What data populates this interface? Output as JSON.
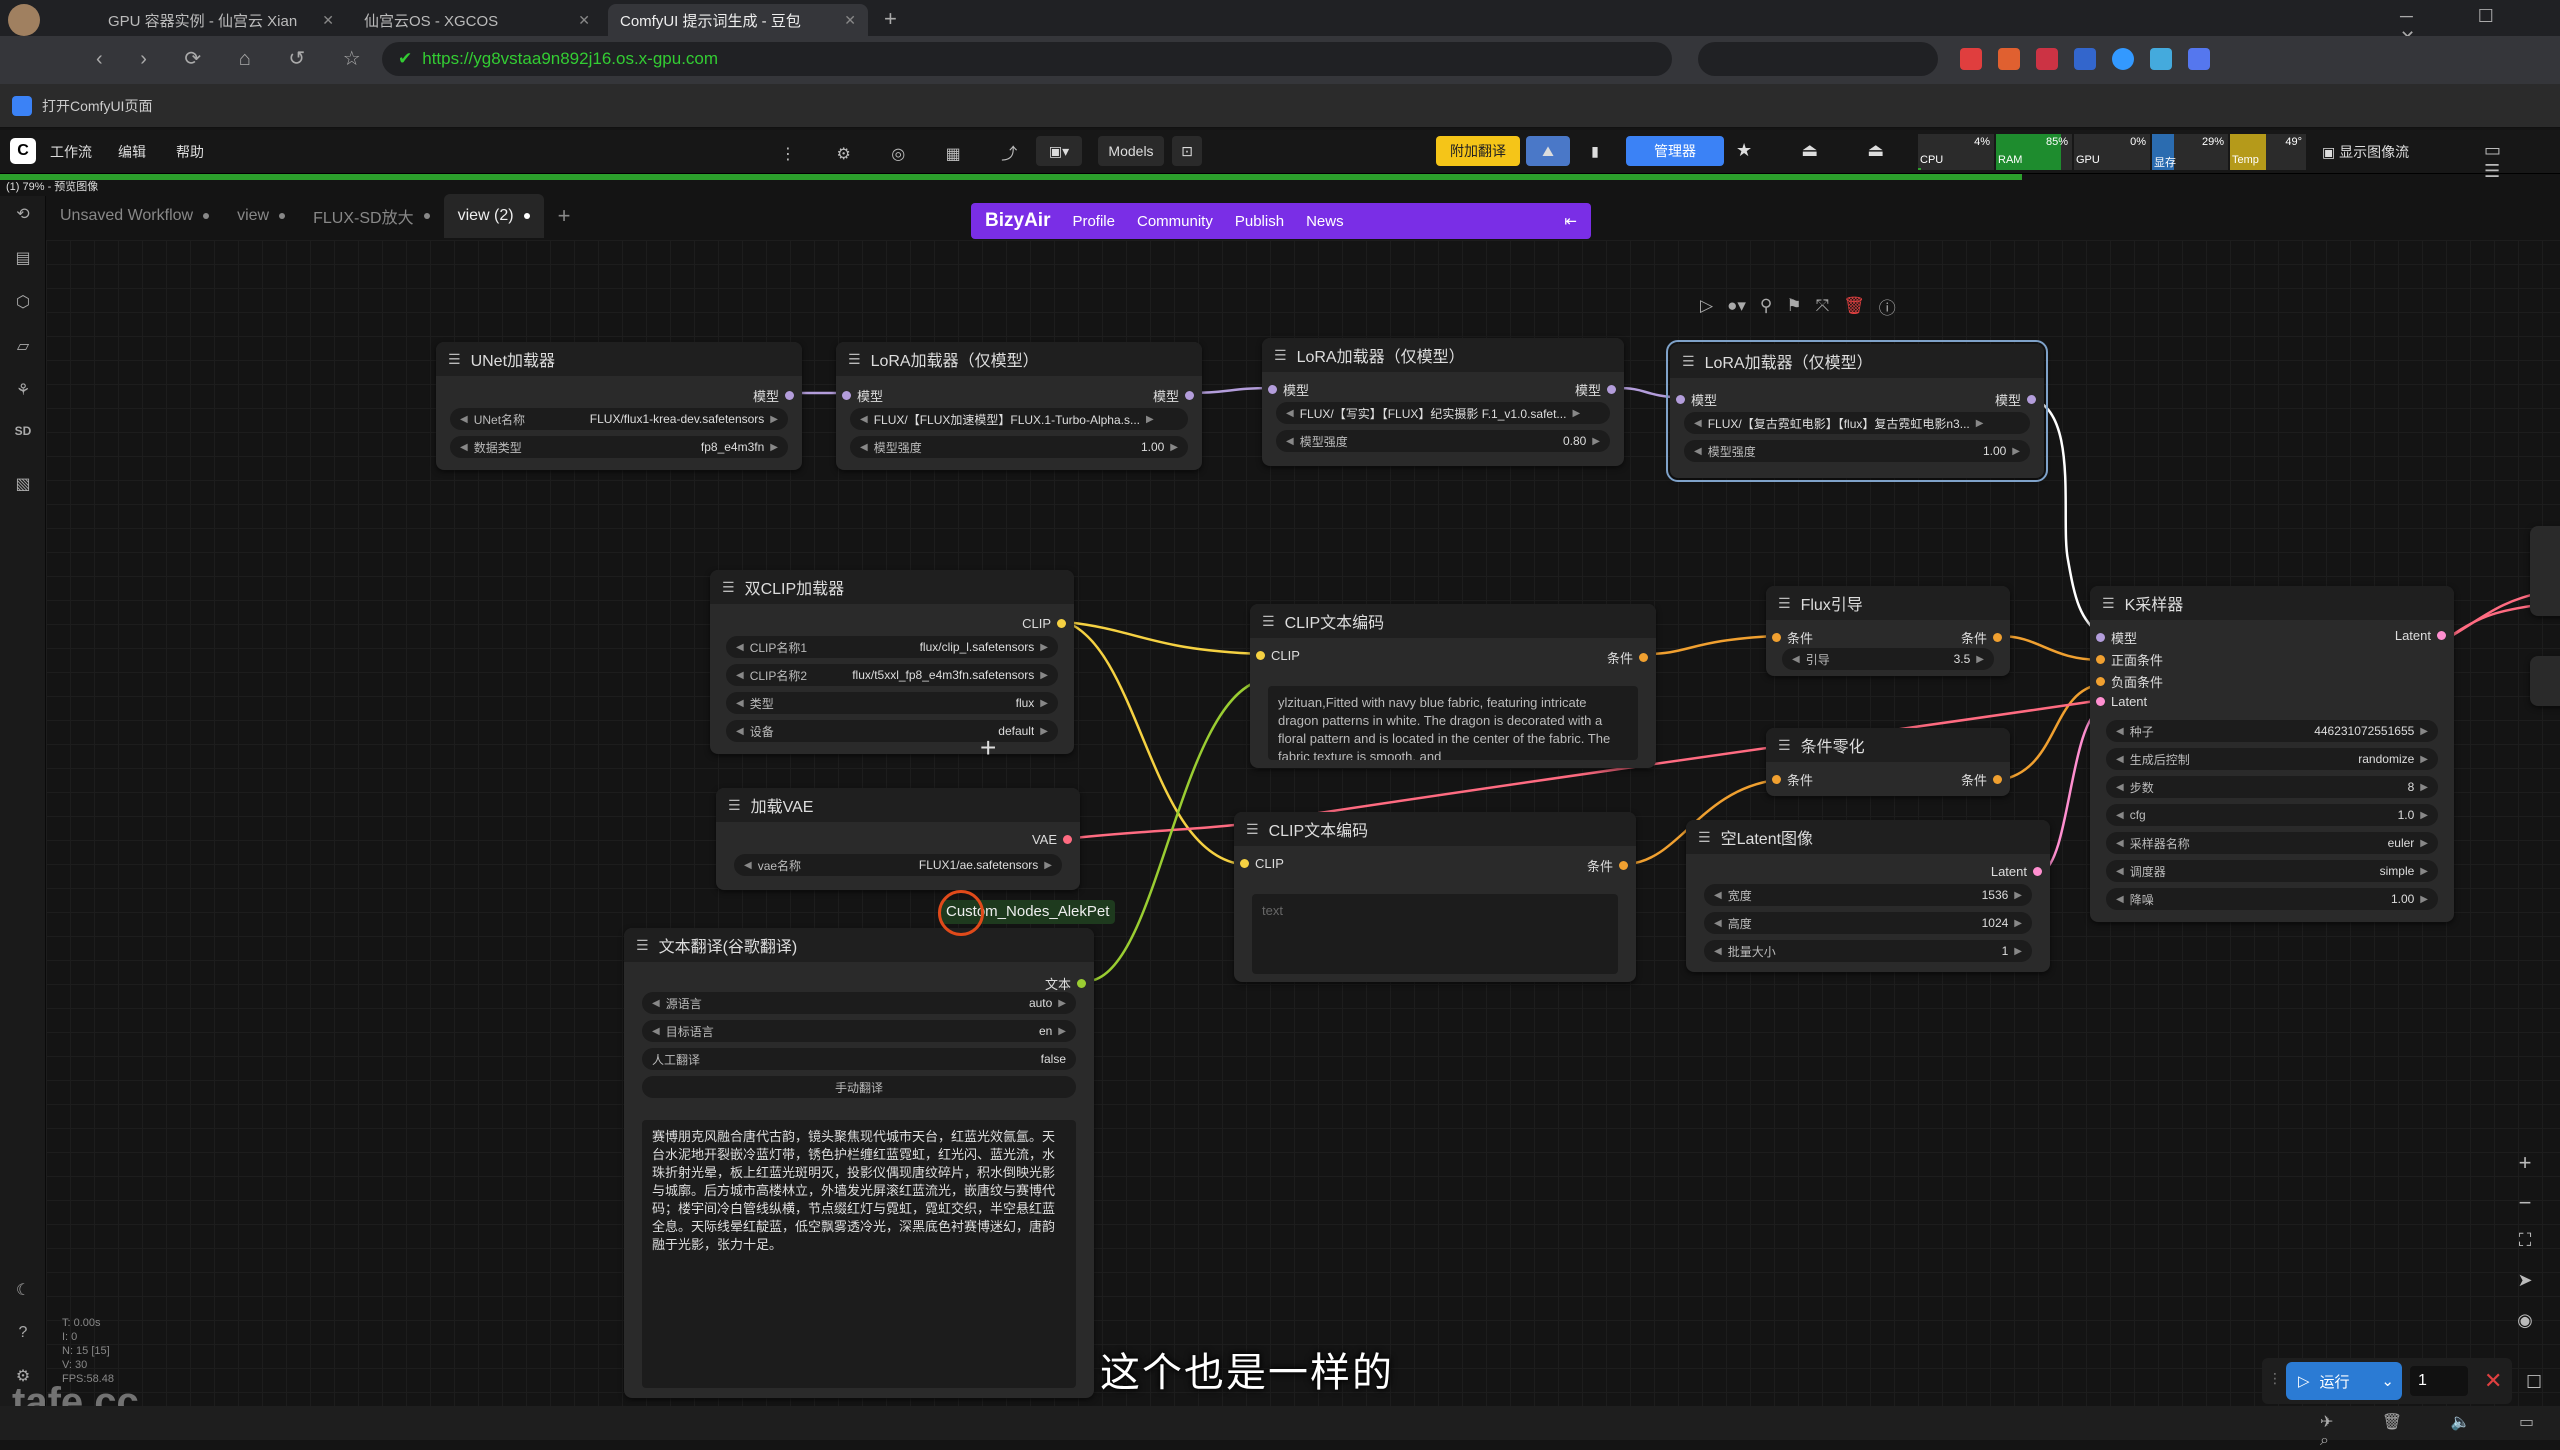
{
  "browser": {
    "tabs": [
      {
        "title": "GPU 容器实例 - 仙宫云 Xian"
      },
      {
        "title": "仙宫云OS - XGCOS"
      },
      {
        "title": "ComfyUI 提示词生成 - 豆包"
      }
    ],
    "url": "https://yg8vstaa9n892j16.os.x-gpu.com",
    "page_title": "打开ComfyUI页面"
  },
  "comfy_menu": {
    "items": [
      "工作流",
      "编辑",
      "帮助"
    ],
    "models_label": "Models",
    "translate_label": "附加翻译",
    "manager_label": "管理器",
    "stats": {
      "cpu_label": "CPU",
      "cpu": "4%",
      "ram_label": "RAM",
      "ram": "85%",
      "gpu_label": "GPU",
      "gpu": "0%",
      "vram_label": "显存",
      "vram": "29%",
      "temp_label": "Temp",
      "temp": "49°"
    },
    "display_label": "显示图像流"
  },
  "progress": {
    "text": "(1) 79% - 预览图像",
    "fraction": 0.79
  },
  "workflow_tabs": [
    {
      "label": "Unsaved Workflow",
      "active": false
    },
    {
      "label": "view",
      "active": false
    },
    {
      "label": "FLUX-SD放大",
      "active": false
    },
    {
      "label": "view (2)",
      "active": true
    }
  ],
  "bizyair": {
    "brand": "BizyAir",
    "links": [
      "Profile",
      "Community",
      "Publish",
      "News"
    ]
  },
  "nodes": {
    "unet": {
      "title": "UNet加载器",
      "out": "模型",
      "w1l": "UNet名称",
      "w1v": "FLUX/flux1-krea-dev.safetensors",
      "w2l": "数据类型",
      "w2v": "fp8_e4m3fn"
    },
    "lora1": {
      "title": "LoRA加载器（仅模型）",
      "in": "模型",
      "out": "模型",
      "w1v": "FLUX/【FLUX加速模型】FLUX.1-Turbo-Alpha.s...",
      "w2l": "模型强度",
      "w2v": "1.00"
    },
    "lora2": {
      "title": "LoRA加载器（仅模型）",
      "in": "模型",
      "out": "模型",
      "w1v": "FLUX/【写实】【FLUX】纪实摄影 F.1_v1.0.safet...",
      "w2l": "模型强度",
      "w2v": "0.80"
    },
    "lora3": {
      "title": "LoRA加载器（仅模型）",
      "in": "模型",
      "out": "模型",
      "w1v": "FLUX/【复古霓虹电影】【flux】复古霓虹电影n3...",
      "w2l": "模型强度",
      "w2v": "1.00"
    },
    "dualclip": {
      "title": "双CLIP加载器",
      "out": "CLIP",
      "w1l": "CLIP名称1",
      "w1v": "flux/clip_l.safetensors",
      "w2l": "CLIP名称2",
      "w2v": "flux/t5xxl_fp8_e4m3fn.safetensors",
      "w3l": "类型",
      "w3v": "flux",
      "w4l": "设备",
      "w4v": "default"
    },
    "vae": {
      "title": "加载VAE",
      "out": "VAE",
      "w1l": "vae名称",
      "w1v": "FLUX1/ae.safetensors"
    },
    "clipenc1": {
      "title": "CLIP文本编码",
      "in": "CLIP",
      "out": "条件",
      "text": "ylzituan,Fitted with navy blue fabric, featuring intricate dragon patterns in white. The dragon is decorated with a floral pattern and is located in the center of the fabric. The fabric texture is smooth, and"
    },
    "clipenc2": {
      "title": "CLIP文本编码",
      "in": "CLIP",
      "out": "条件",
      "placeholder": "text"
    },
    "fluxguide": {
      "title": "Flux引导",
      "in": "条件",
      "out": "条件",
      "w1l": "引导",
      "w1v": "3.5"
    },
    "condzero": {
      "title": "条件零化",
      "in": "条件",
      "out": "条件"
    },
    "emptylatent": {
      "title": "空Latent图像",
      "out": "Latent",
      "w1l": "宽度",
      "w1v": "1536",
      "w2l": "高度",
      "w2v": "1024",
      "w3l": "批量大小",
      "w3v": "1"
    },
    "ksampler": {
      "title": "K采样器",
      "in1": "模型",
      "in2": "正面条件",
      "in3": "负面条件",
      "in4": "Latent",
      "out": "Latent",
      "widgets": [
        {
          "label": "种子",
          "value": "446231072551655"
        },
        {
          "label": "生成后控制",
          "value": "randomize"
        },
        {
          "label": "步数",
          "value": "8"
        },
        {
          "label": "cfg",
          "value": "1.0"
        },
        {
          "label": "采样器名称",
          "value": "euler"
        },
        {
          "label": "调度器",
          "value": "simple"
        },
        {
          "label": "降噪",
          "value": "1.00"
        }
      ]
    },
    "translate": {
      "title": "文本翻译(谷歌翻译)",
      "out": "文本",
      "badge": "Custom_Nodes_AlekPet",
      "w1l": "源语言",
      "w1v": "auto",
      "w2l": "目标语言",
      "w2v": "en",
      "w3l": "人工翻译",
      "w3v": "false",
      "button": "手动翻译",
      "text": "赛博朋克风融合唐代古韵，镜头聚焦现代城市天台，红蓝光效氤氲。天台水泥地开裂嵌冷蓝灯带，锈色护栏缠红蓝霓虹，红光闪、蓝光流，水珠折射光晕，板上红蓝光斑明灭，投影仪偶现唐纹碎片，积水倒映光影与城廓。后方城市高楼林立，外墙发光屏滚红蓝流光，嵌唐纹与赛博代码；楼宇间冷白管线纵横，节点缀红灯与霓虹，霓虹交织，半空悬红蓝全息。天际线晕红靛蓝，低空飘雾透冷光，深黑底色衬赛博迷幻，唐韵融于光影，张力十足。"
    }
  },
  "stats_overlay": [
    "T: 0.00s",
    "I: 0",
    "N: 15 [15]",
    "V: 30",
    "FPS:58.48"
  ],
  "subtitle": "这个也是一样的",
  "watermark": "tafe.cc",
  "run": {
    "label": "运行",
    "count": "1"
  },
  "colors": {
    "accent": "#7a2ee6",
    "progress": "#2ca02c",
    "model_link": "#b39ddb",
    "clip_link": "#f5d142",
    "cond_link": "#f0a030",
    "vae_link": "#ff6b81",
    "latent_link": "#ff8fd0",
    "text_link": "#9acd32"
  }
}
